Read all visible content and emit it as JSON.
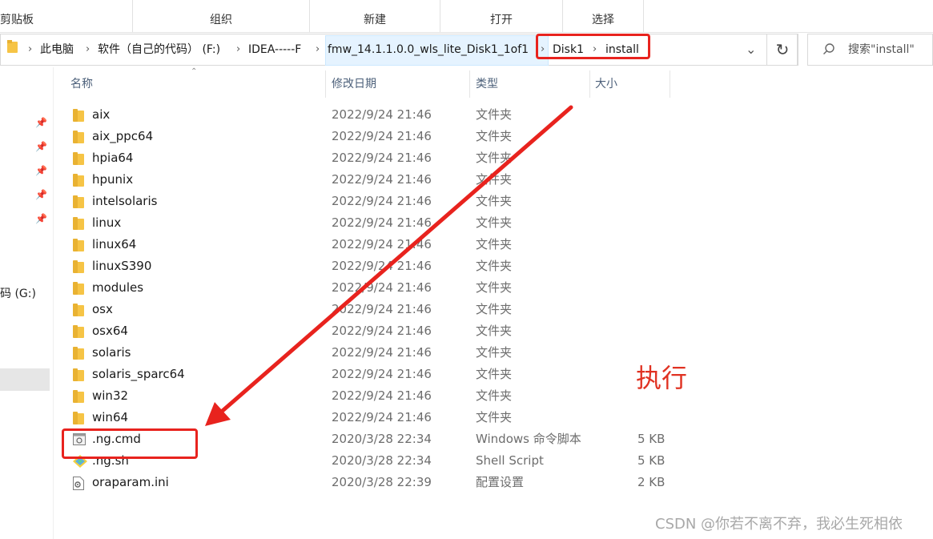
{
  "ribbon": {
    "groups": [
      "剪贴板",
      "组织",
      "新建",
      "打开",
      "选择"
    ]
  },
  "address": {
    "crumbs": [
      "此电脑",
      "软件（自己的代码） (F:)",
      "IDEA-----F",
      "fmw_14.1.1.0.0_wls_lite_Disk1_1of1",
      "Disk1",
      "install"
    ],
    "dropdown_icon": "chevron-down-icon",
    "refresh_icon": "refresh-icon"
  },
  "search": {
    "placeholder": "搜索\"install\"",
    "icon": "search-icon"
  },
  "nav": {
    "drive_label": "代码 (G:)"
  },
  "columns": {
    "name": "名称",
    "date": "修改日期",
    "type": "类型",
    "size": "大小"
  },
  "files": [
    {
      "name": "aix",
      "date": "2022/9/24 21:46",
      "type": "文件夹",
      "size": "",
      "kind": "folder"
    },
    {
      "name": "aix_ppc64",
      "date": "2022/9/24 21:46",
      "type": "文件夹",
      "size": "",
      "kind": "folder"
    },
    {
      "name": "hpia64",
      "date": "2022/9/24 21:46",
      "type": "文件夹",
      "size": "",
      "kind": "folder"
    },
    {
      "name": "hpunix",
      "date": "2022/9/24 21:46",
      "type": "文件夹",
      "size": "",
      "kind": "folder"
    },
    {
      "name": "intelsolaris",
      "date": "2022/9/24 21:46",
      "type": "文件夹",
      "size": "",
      "kind": "folder"
    },
    {
      "name": "linux",
      "date": "2022/9/24 21:46",
      "type": "文件夹",
      "size": "",
      "kind": "folder"
    },
    {
      "name": "linux64",
      "date": "2022/9/24 21:46",
      "type": "文件夹",
      "size": "",
      "kind": "folder"
    },
    {
      "name": "linuxS390",
      "date": "2022/9/24 21:46",
      "type": "文件夹",
      "size": "",
      "kind": "folder"
    },
    {
      "name": "modules",
      "date": "2022/9/24 21:46",
      "type": "文件夹",
      "size": "",
      "kind": "folder"
    },
    {
      "name": "osx",
      "date": "2022/9/24 21:46",
      "type": "文件夹",
      "size": "",
      "kind": "folder"
    },
    {
      "name": "osx64",
      "date": "2022/9/24 21:46",
      "type": "文件夹",
      "size": "",
      "kind": "folder"
    },
    {
      "name": "solaris",
      "date": "2022/9/24 21:46",
      "type": "文件夹",
      "size": "",
      "kind": "folder"
    },
    {
      "name": "solaris_sparc64",
      "date": "2022/9/24 21:46",
      "type": "文件夹",
      "size": "",
      "kind": "folder"
    },
    {
      "name": "win32",
      "date": "2022/9/24 21:46",
      "type": "文件夹",
      "size": "",
      "kind": "folder"
    },
    {
      "name": "win64",
      "date": "2022/9/24 21:46",
      "type": "文件夹",
      "size": "",
      "kind": "folder"
    },
    {
      "name": ".ng.cmd",
      "date": "2020/3/28 22:34",
      "type": "Windows 命令脚本",
      "size": "5 KB",
      "kind": "cmd"
    },
    {
      "name": ".ng.sh",
      "date": "2020/3/28 22:34",
      "type": "Shell Script",
      "size": "5 KB",
      "kind": "sh"
    },
    {
      "name": "oraparam.ini",
      "date": "2020/3/28 22:39",
      "type": "配置设置",
      "size": "2 KB",
      "kind": "ini"
    }
  ],
  "annotation": {
    "label": "执行",
    "color": "#e8231e"
  },
  "watermark": "CSDN @你若不离不弃，我必生死相依"
}
